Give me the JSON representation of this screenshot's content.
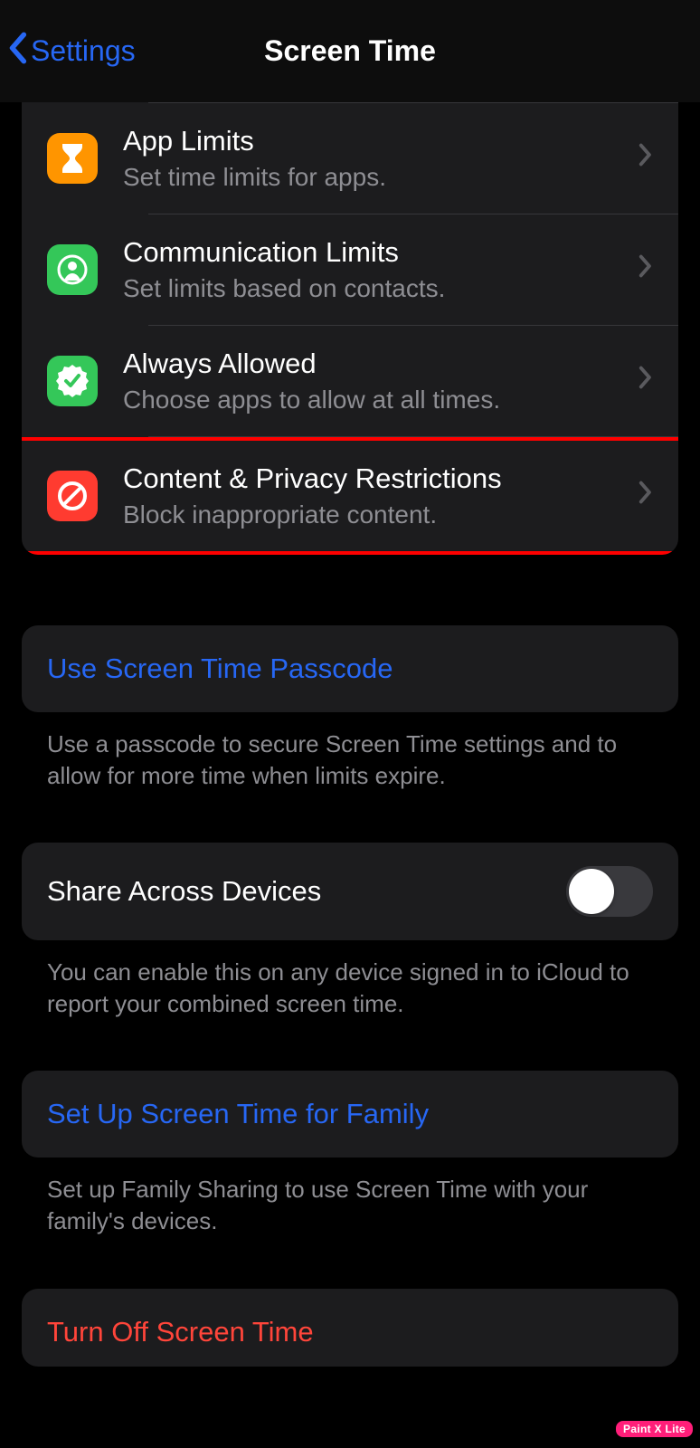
{
  "header": {
    "back_label": "Settings",
    "title": "Screen Time"
  },
  "items": [
    {
      "title": "App Limits",
      "subtitle": "Set time limits for apps."
    },
    {
      "title": "Communication Limits",
      "subtitle": "Set limits based on contacts."
    },
    {
      "title": "Always Allowed",
      "subtitle": "Choose apps to allow at all times."
    },
    {
      "title": "Content & Privacy Restrictions",
      "subtitle": "Block inappropriate content."
    }
  ],
  "passcode": {
    "link": "Use Screen Time Passcode",
    "footer": "Use a passcode to secure Screen Time settings and to allow for more time when limits expire."
  },
  "share": {
    "label": "Share Across Devices",
    "footer": "You can enable this on any device signed in to iCloud to report your combined screen time."
  },
  "family": {
    "link": "Set Up Screen Time for Family",
    "footer": "Set up Family Sharing to use Screen Time with your family's devices."
  },
  "turnoff": {
    "link": "Turn Off Screen Time"
  },
  "watermark": "Paint X Lite"
}
